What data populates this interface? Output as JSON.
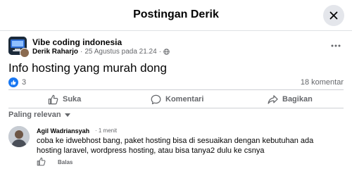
{
  "modal": {
    "title": "Postingan Derik"
  },
  "post": {
    "group_name": "Vibe coding indonesia",
    "author": "Derik Raharjo",
    "separator": "·",
    "timestamp": "25 Agustus pada 21.24",
    "privacy_separator": "·",
    "text": "Info hosting yang murah dong",
    "reaction_count": "3",
    "comment_count": "18 komentar"
  },
  "actions": {
    "like": "Suka",
    "comment": "Komentari",
    "share": "Bagikan"
  },
  "sort": {
    "label": "Paling relevan"
  },
  "comment": {
    "author": "Agil Wadriansyah",
    "time": "· 1 menit",
    "text": "coba ke idwebhost bang, paket hosting bisa di sesuaikan dengan kebutuhan ada hosting laravel, wordpress hosting, atau bisa tanya2 dulu ke csnya",
    "reply_label": "Balas"
  },
  "colors": {
    "accent": "#1877f2",
    "secondary_text": "#65676b",
    "close_button_bg": "#e4e6eb"
  },
  "icons": {
    "close": "close-icon",
    "more": "more-icon",
    "privacy": "globe-icon",
    "reaction": "thumbs-up-icon",
    "sort": "caret-down-icon"
  }
}
